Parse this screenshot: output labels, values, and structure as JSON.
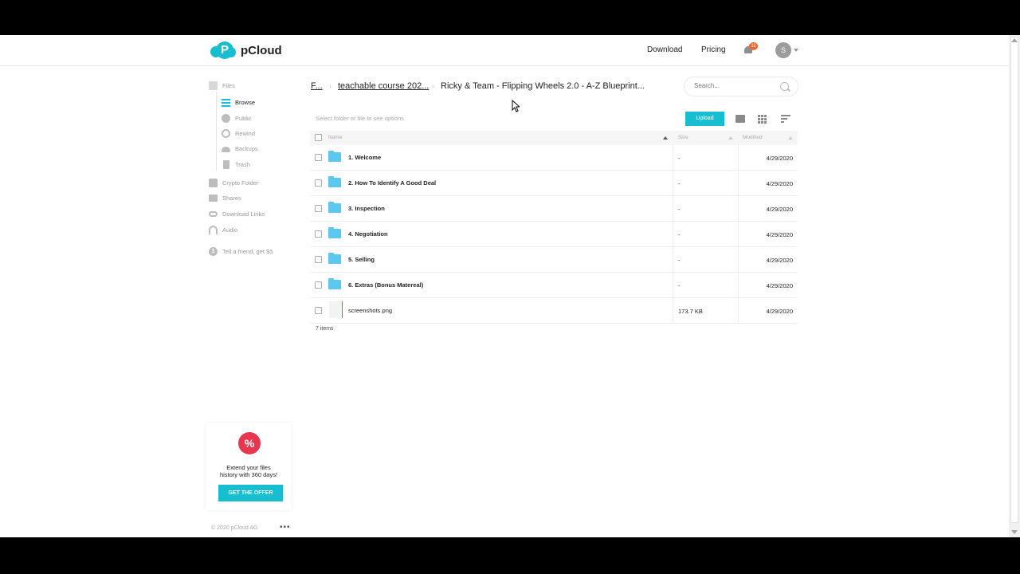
{
  "header": {
    "logo_text": "pCloud",
    "nav": [
      "Download",
      "Pricing"
    ],
    "notification_count": "11",
    "avatar_initial": "S"
  },
  "sidebar": {
    "items": [
      {
        "label": "Files",
        "icon": "file-icon",
        "active": false
      },
      {
        "label": "Browse",
        "icon": "list-icon",
        "active": true
      },
      {
        "label": "Public",
        "icon": "globe-icon",
        "active": false
      },
      {
        "label": "Rewind",
        "icon": "rewind-icon",
        "active": false
      },
      {
        "label": "Backups",
        "icon": "cloud-icon",
        "active": false
      },
      {
        "label": "Trash",
        "icon": "trash-icon",
        "active": false
      },
      {
        "label": "Crypto Folder",
        "icon": "lock-icon",
        "active": false
      },
      {
        "label": "Shares",
        "icon": "shared-folder-icon",
        "active": false
      },
      {
        "label": "Download Links",
        "icon": "link-icon",
        "active": false
      },
      {
        "label": "Audio",
        "icon": "headphones-icon",
        "active": false
      },
      {
        "label": "Tell a friend, get $5",
        "icon": "dollar-icon",
        "active": false
      }
    ],
    "promo": {
      "badge": "%",
      "text_line1": "Extend your files",
      "text_line2": "history with 360 days!",
      "button": "GET THE OFFER"
    },
    "copyright": "© 2020 pCloud AG",
    "more": "•••"
  },
  "breadcrumb": {
    "root": "F...",
    "parent": "teachable course 202...",
    "current": "Ricky & Team - Flipping Wheels 2.0 - A-Z Blueprint..."
  },
  "search": {
    "placeholder": "Search..."
  },
  "toolbar": {
    "hint": "Select folder or file to see options",
    "upload": "Upload"
  },
  "table": {
    "columns": [
      "Name",
      "Size",
      "Modified"
    ],
    "rows": [
      {
        "name": "1. Welcome",
        "type": "folder",
        "size": "-",
        "modified": "4/29/2020"
      },
      {
        "name": "2. How To Identify A Good Deal",
        "type": "folder",
        "size": "-",
        "modified": "4/29/2020"
      },
      {
        "name": "3. Inspection",
        "type": "folder",
        "size": "-",
        "modified": "4/29/2020"
      },
      {
        "name": "4. Negotiation",
        "type": "folder",
        "size": "-",
        "modified": "4/29/2020"
      },
      {
        "name": "5. Selling",
        "type": "folder",
        "size": "-",
        "modified": "4/29/2020"
      },
      {
        "name": "6. Extras (Bonus Matereal)",
        "type": "folder",
        "size": "-",
        "modified": "4/29/2020"
      },
      {
        "name": "screenshots.png",
        "type": "file",
        "size": "173.7 KB",
        "modified": "4/29/2020"
      }
    ],
    "count": "7 items"
  },
  "colors": {
    "accent": "#17bed0",
    "folder": "#5cc8f0",
    "promo_badge": "#e8364f",
    "notification_badge": "#f0642d"
  }
}
